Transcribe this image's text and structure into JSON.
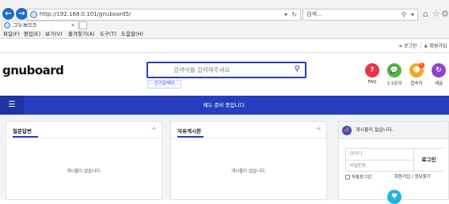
{
  "browser": {
    "url": "http://192.168.0.101/gnuboard5/",
    "search_placeholder": "검색...",
    "tab_title": "그누보드5",
    "menu": [
      "파일(F)",
      "편집(E)",
      "보기(V)",
      "즐겨찾기(A)",
      "도구(T)",
      "도움말(H)"
    ]
  },
  "tnb": {
    "login": "로그인",
    "register": "회원가입"
  },
  "header": {
    "logo": "gnuboard",
    "search_placeholder": "검색어를 입력해주세요",
    "popular_label": "인기검색어",
    "quick": [
      {
        "label": "FAQ",
        "icon": "?",
        "color": "#e8334a"
      },
      {
        "label": "1:1문의",
        "icon": "💬",
        "color": "#4cba3c"
      },
      {
        "label": "접속자",
        "icon": "☻",
        "color": "#f5a623",
        "badge": "1"
      },
      {
        "label": "새글",
        "icon": "↻",
        "color": "#8e44c9"
      }
    ]
  },
  "gnb": {
    "message": "메뉴 준비 중입니다."
  },
  "boards": [
    {
      "title": "질문답변",
      "empty": "게시물이 없습니다."
    },
    {
      "title": "자유게시판",
      "empty": "게시물이 없습니다."
    }
  ],
  "sidebar": {
    "notice": "게시물이 없습니다.",
    "id_placeholder": "아이디",
    "pw_placeholder": "비밀번호",
    "login_button": "로그인",
    "auto_login": "자동로그인",
    "register": "회원가입",
    "find": "정보찾기"
  },
  "colors": {
    "brand": "#253dbe"
  }
}
